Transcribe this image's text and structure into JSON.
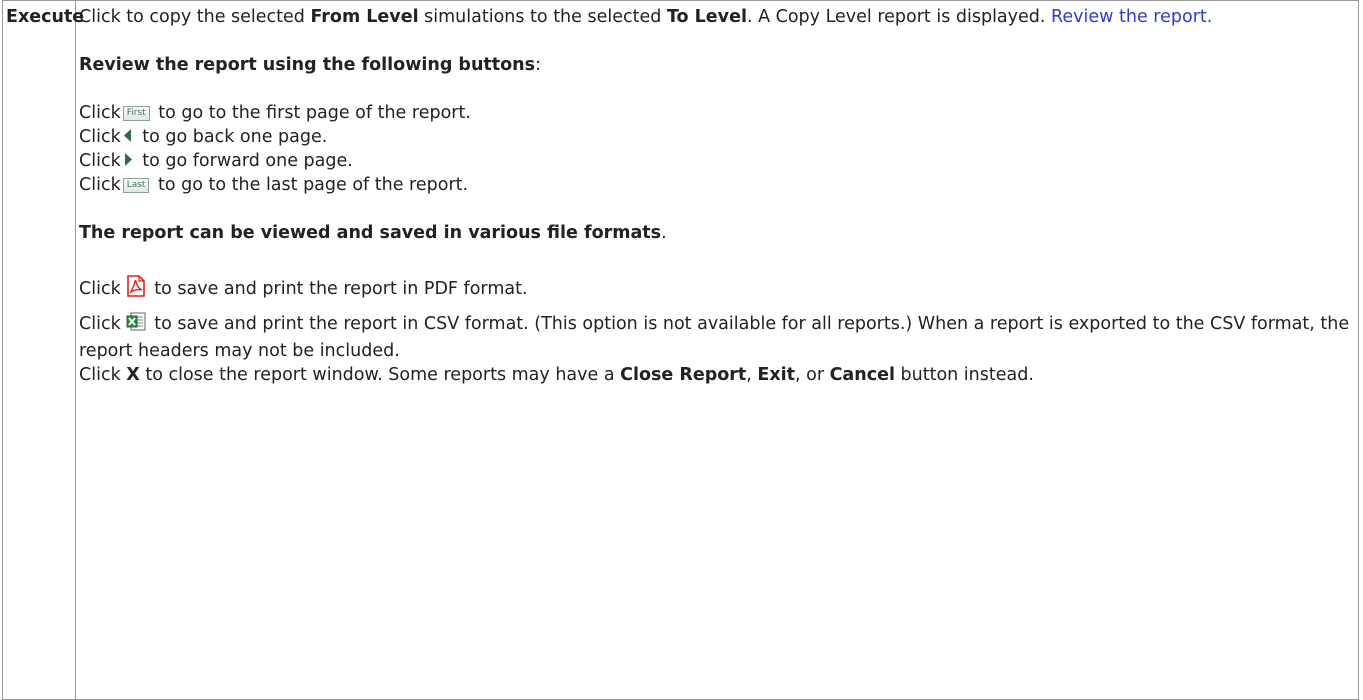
{
  "table": {
    "label": "Execute",
    "intro": {
      "part1": "Click to copy the selected ",
      "from_level": "From Level",
      "part2": " simulations to the selected ",
      "to_level": "To Level",
      "part3": ". A Copy Level report is displayed. ",
      "link": "Review the report."
    },
    "review_heading": "Review the report using the following buttons",
    "review_colon": ":",
    "nav_items": [
      {
        "click": "Click",
        "icon": "first-button-icon",
        "icon_text": "First",
        "text": " to go to the first page of the report."
      },
      {
        "click": "Click",
        "icon": "arrow-left-icon",
        "text": " to go back one page."
      },
      {
        "click": "Click",
        "icon": "arrow-right-icon",
        "text": " to go forward one page."
      },
      {
        "click": "Click",
        "icon": "last-button-icon",
        "icon_text": "Last",
        "text": " to go to the last page of the report."
      }
    ],
    "formats_heading": "The report can be viewed and saved in various file formats",
    "formats_period": ".",
    "pdf": {
      "click": "Click",
      "text": " to save and print the report in PDF format."
    },
    "csv": {
      "click": "Click",
      "text": " to save and print the report in CSV format. (This option is not available for all reports.) When a report is exported to the CSV format, the report headers may not be included."
    },
    "close": {
      "click": "Click ",
      "x": "X",
      "text1": " to close the report window. Some reports may have a ",
      "close_report": "Close Report",
      "comma1": ", ",
      "exit": "Exit",
      "comma2": ", or ",
      "cancel": "Cancel",
      "text2": " button instead."
    }
  },
  "colors": {
    "link": "#2b3bd6",
    "pdf_icon": "#d6251f",
    "csv_icon": "#2e8b3a",
    "arrow_icon": "#2f6a4a"
  }
}
